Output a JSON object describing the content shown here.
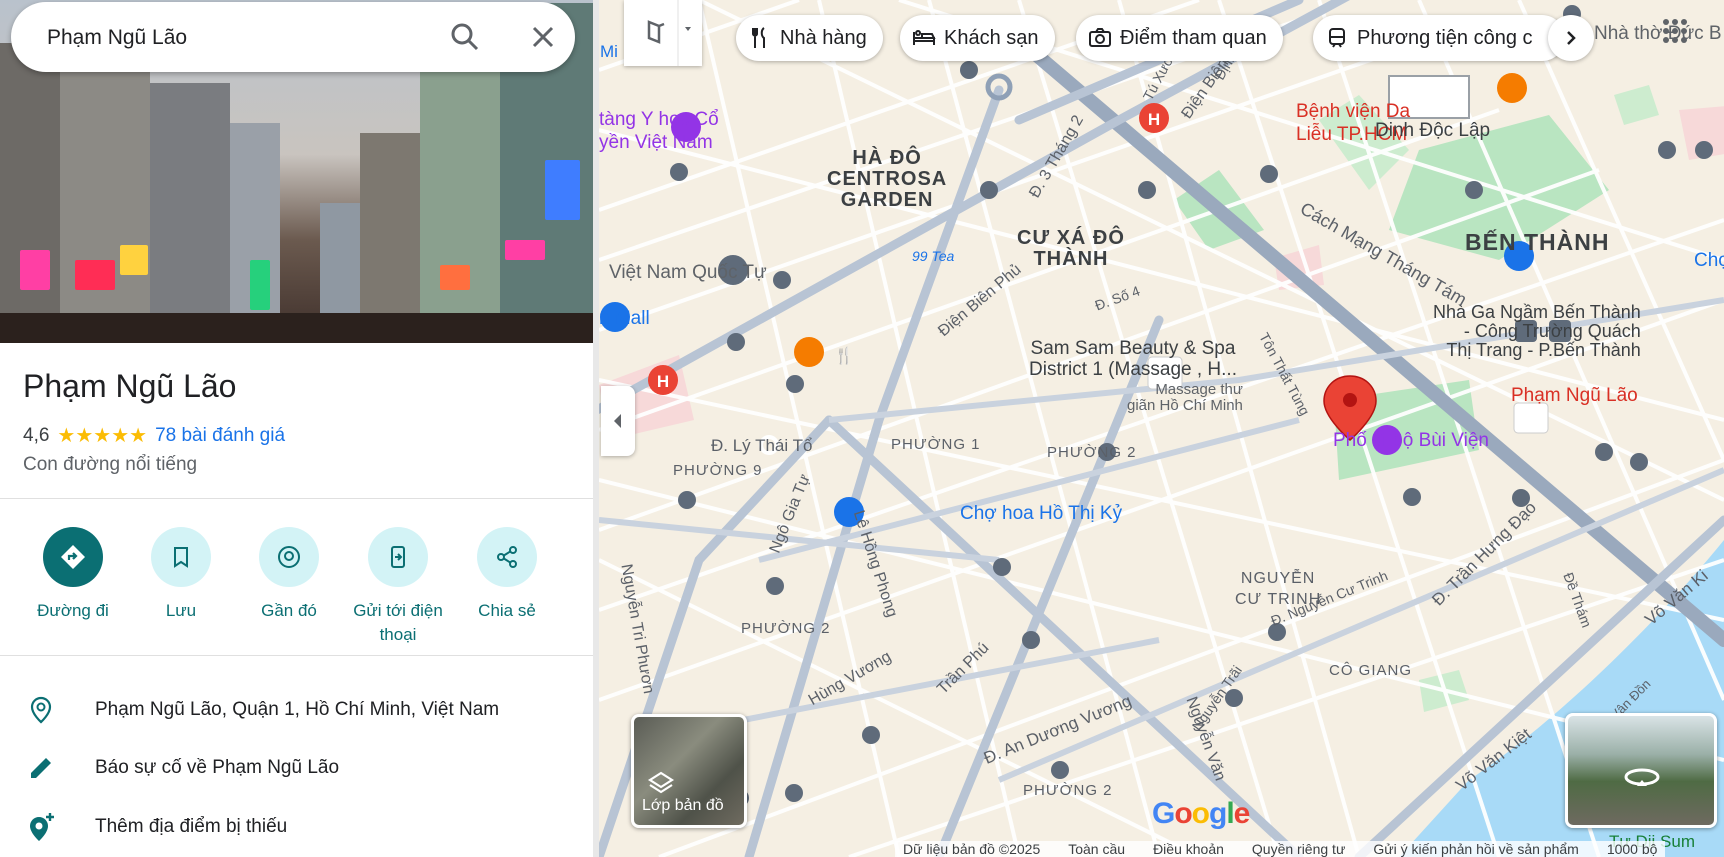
{
  "search": {
    "value": "Phạm Ngũ Lão"
  },
  "place": {
    "title": "Phạm Ngũ Lão",
    "rating": "4,6",
    "stars": "★★★★★",
    "reviews": "78 bài đánh giá",
    "category": "Con đường nổi tiếng"
  },
  "actions": [
    {
      "label": "Đường đi",
      "icon": "directions-icon"
    },
    {
      "label": "Lưu",
      "icon": "bookmark-icon"
    },
    {
      "label": "Gần đó",
      "icon": "nearby-icon"
    },
    {
      "label": "Gửi tới điện thoại",
      "icon": "send-to-phone-icon"
    },
    {
      "label": "Chia sẻ",
      "icon": "share-icon"
    }
  ],
  "info": {
    "address": "Phạm Ngũ Lão, Quận 1, Hồ Chí Minh, Việt Nam",
    "report": "Báo sự cố về Phạm Ngũ Lão",
    "add_place": "Thêm địa điểm bị thiếu"
  },
  "chips": [
    {
      "label": "Nhà hàng",
      "icon": "restaurant-icon"
    },
    {
      "label": "Khách sạn",
      "icon": "hotel-icon"
    },
    {
      "label": "Điểm tham quan",
      "icon": "camera-icon"
    },
    {
      "label": "Phương tiện công c",
      "icon": "transit-icon"
    }
  ],
  "map_labels": {
    "ha_do": "HÀ ĐÔ\nCENTROSA\nGARDEN",
    "cu_xa": "CƯ XÁ ĐÔ\nTHÀNH",
    "ben_thanh": "BẾN THÀNH",
    "nguyen_cu_trinh": "NGUYỄN\nCƯ TRINH",
    "co_giang": "CÔ GIANG",
    "phuong1": "PHƯỜNG 1",
    "phuong2a": "PHƯỜNG 2",
    "phuong9": "PHƯỜNG 9",
    "phuong2b": "PHƯỜNG 2",
    "phuong2c": "PHƯỜNG 2",
    "bao_tang": "tàng Y học Cổ\nyền Việt Nam",
    "viet_nam_quoc_tu": "Việt Nam Quốc Tự",
    "mall": "n Mall",
    "benh_vien": "Bệnh viện Da\nLiễu TP.HCM",
    "dinh_doc_lap": "Dinh Độc Lập",
    "nha_tho": "Nhà thờ Đức B",
    "sam_sam": "Sam Sam Beauty & Spa\nDistrict 1 (Massage , H...",
    "massage": "Massage thư\ngiãn Hồ Chí Minh",
    "nha_ga": "Nhà Ga Ngầm Bến Thành\n- Công Trường Quách\nThị Trang - P.Bến Thành",
    "pham_ngu_lao": "Phạm Ngũ Lão",
    "bui_vien": "Phố đi bộ Bùi Viện",
    "cho_hoa": "Chợ hoa Hồ Thị Kỷ",
    "tea": "99 Tea",
    "cho_right": "Chợ",
    "tu_di_sum": "Tư Dii Sum",
    "mi": "Mi",
    "st_3thang2": "Đ. 3 Tháng 2",
    "st_dien_bien_phu_top": "Điện Biên",
    "st_dien_bien_phu": "Điện Biên Phủ",
    "st_cmt8": "Cách Mạng Tháng Tám",
    "st_so4": "Đ. Số 4",
    "st_ton_that_tung": "Tôn Thất Tùng",
    "st_ly_thai_to": "Đ. Lý Thái Tổ",
    "st_ngo_gia_tu": "Ngô Gia Tự",
    "st_le_hong_phong": "Lê Hồng Phong",
    "st_nguyen_tri_phuong": "Nguyễn Tri Phươn",
    "st_hung_vuong": "Hùng Vương",
    "st_tran_phu": "Trần Phú",
    "st_an_duong_vuong": "Đ. An Dương Vương",
    "st_nguyen_van": "Nguyễn Văn",
    "st_nguyen_trai": "Nguyễn Trãi",
    "st_nguyen_cu_trinh": "Đ. Nguyễn Cư Trinh",
    "st_tran_hung_dao": "Đ. Trần Hưng Đạo",
    "st_de_tham": "Đề Thám",
    "st_vo_van_kiet": "Võ Văn Kiệt",
    "st_vo_van_kiet2": "Võ Văn Ki",
    "st_tu_xuong": "Tú Xươ",
    "st_dinh": "Định",
    "st_vo_van_don": "Vân Đồn"
  },
  "map_controls": {
    "layers": "Lớp bản đồ"
  },
  "footer": {
    "data": "Dữ liệu bản đồ ©2025",
    "global": "Toàn cầu",
    "terms": "Điều khoản",
    "privacy": "Quyền riêng tư",
    "feedback": "Gửi ý kiến phản hồi về sản phẩm",
    "scale": "1000 bộ"
  },
  "colors": {
    "accent": "#0b6f73",
    "red_pin": "#ea4335",
    "poi_purple": "#9334e6",
    "poi_blue": "#1a73e8"
  }
}
